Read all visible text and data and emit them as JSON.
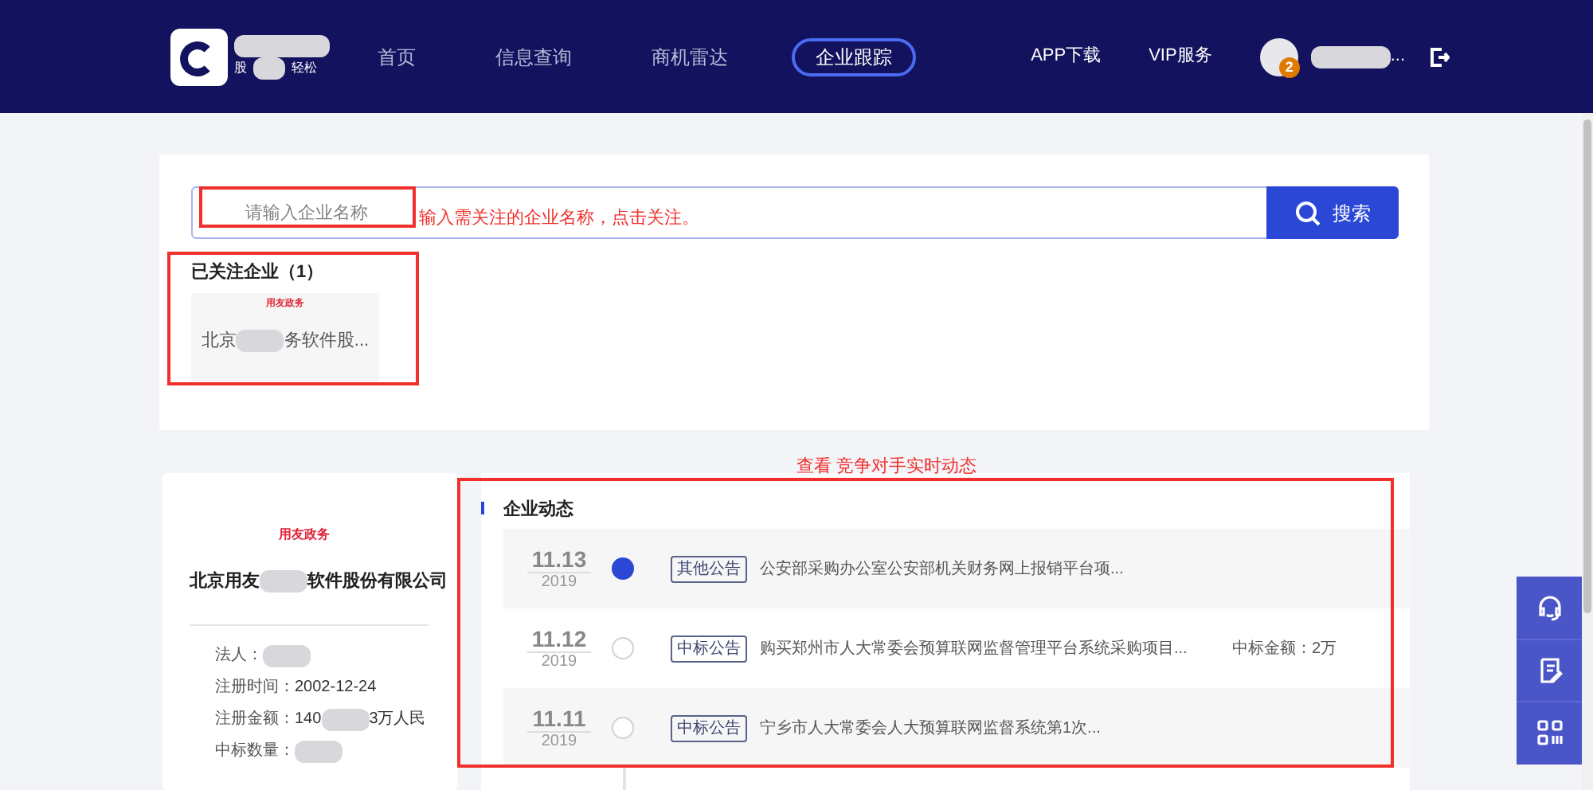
{
  "nav": {
    "logo_sub_parts": [
      "股",
      "轻松"
    ],
    "items": [
      {
        "label": "首页",
        "selected": false
      },
      {
        "label": "信息查询",
        "selected": false
      },
      {
        "label": "商机雷达",
        "selected": false
      },
      {
        "label": "企业跟踪",
        "selected": true
      }
    ],
    "right_links": [
      "APP下载",
      "VIP服务"
    ],
    "badge": "2",
    "user_parts": [
      "..."
    ]
  },
  "search": {
    "placeholder": "请输入企业名称",
    "button": "搜索",
    "annotation": "输入需关注的企业名称，点击关注。"
  },
  "followed": {
    "title": "已关注企业（1）",
    "companies": [
      {
        "logo": "用友政务",
        "name_parts": [
          "北京",
          "务软件股..."
        ]
      }
    ]
  },
  "company": {
    "logo": "用友政务",
    "name_parts": [
      "北京用友",
      "软件股份有限公司"
    ],
    "fields": [
      {
        "label": "法人："
      },
      {
        "label": "注册时间：",
        "value_parts": [
          "2002-12-24"
        ]
      },
      {
        "label": "注册金额：",
        "value_parts": [
          "140",
          "3万人民"
        ]
      },
      {
        "label": "中标数量："
      }
    ]
  },
  "timeline": {
    "annotation": "查看 竞争对手实时动态",
    "title": "企业动态",
    "events": [
      {
        "date": "11.13",
        "year": "2019",
        "tag": "其他公告",
        "text": "公安部采购办公室公安部机关财务网上报销平台项...",
        "selected": true
      },
      {
        "date": "11.12",
        "year": "2019",
        "tag": "中标公告",
        "text": "购买郑州市人大常委会预算联网监督管理平台系统采购项目...",
        "extra": "中标金额：2万",
        "selected": false
      },
      {
        "date": "11.11",
        "year": "2019",
        "tag": "中标公告",
        "text": "宁乡市人大常委会人大预算联网监督系统第1次...",
        "selected": false
      }
    ]
  }
}
